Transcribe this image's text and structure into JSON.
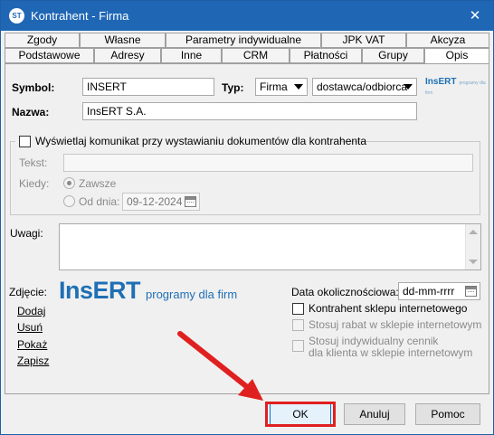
{
  "window": {
    "title": "Kontrahent - Firma",
    "icon_label": "ST"
  },
  "tabs_row1": [
    "Zgody",
    "Własne",
    "Parametry indywidualne",
    "JPK VAT",
    "Akcyza"
  ],
  "tabs_row2": [
    "Podstawowe",
    "Adresy",
    "Inne",
    "CRM",
    "Płatności",
    "Grupy",
    "Opis"
  ],
  "form": {
    "symbol_label": "Symbol:",
    "symbol_value": "INSERT",
    "typ_label": "Typ:",
    "typ_value": "Firma",
    "role_value": "dostawca/odbiorca",
    "nazwa_label": "Nazwa:",
    "nazwa_value": "InsERT S.A.",
    "logo_small": "InsERT",
    "logo_small_sub": "programy dla firm"
  },
  "message": {
    "checkbox_label": "Wyświetlaj komunikat przy wystawianiu dokumentów dla kontrahenta",
    "tekst_label": "Tekst:",
    "kiedy_label": "Kiedy:",
    "zawsze_label": "Zawsze",
    "od_dnia_label": "Od dnia:",
    "od_dnia_value": "09-12-2024"
  },
  "uwagi": {
    "label": "Uwagi:"
  },
  "photo": {
    "label": "Zdjęcie:",
    "logo_main": "InsERT",
    "logo_tagline": "programy dla firm",
    "links": [
      "Dodaj",
      "Usuń",
      "Pokaż",
      "Zapisz"
    ]
  },
  "right": {
    "date_label": "Data okolicznościowa:",
    "date_placeholder": "dd-mm-rrrr",
    "shop_label": "Kontrahent sklepu internetowego",
    "rabat_label": "Stosuj rabat w sklepie internetowym",
    "cennik_line1": "Stosuj indywidualny cennik",
    "cennik_line2": "dla klienta w sklepie internetowym"
  },
  "buttons": {
    "ok": "OK",
    "cancel": "Anuluj",
    "help": "Pomoc"
  },
  "colors": {
    "titlebar": "#1f67b5",
    "highlight": "#e02020",
    "brand": "#1f6fb5"
  }
}
